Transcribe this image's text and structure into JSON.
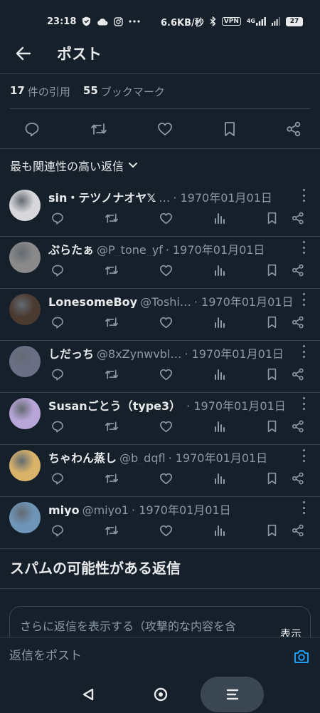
{
  "status_bar": {
    "time": "23:18",
    "left_icons": [
      "shield-icon",
      "cloud-icon",
      "instagram-icon",
      "more-dots-icon"
    ],
    "net_speed": "6.6KB/秒",
    "right_icons": [
      "bluetooth-icon",
      "vpn-icon",
      "signal-icon",
      "wifi-icon"
    ],
    "vpn_label": "VPN",
    "network_label": "4G",
    "battery": "27"
  },
  "header": {
    "back_icon": "arrow-left-icon",
    "title": "ポスト"
  },
  "stats": {
    "quotes_count": "17",
    "quotes_label": "件の引用",
    "bookmarks_count": "55",
    "bookmarks_label": "ブックマーク"
  },
  "post_actions": [
    "reply-icon",
    "repost-icon",
    "like-icon",
    "bookmark-icon",
    "share-icon"
  ],
  "sort": {
    "label": "最も関連性の高い返信",
    "icon": "chevron-down-icon"
  },
  "replies": [
    {
      "name": "sin・テツノナオヤ𝕏",
      "handle": "…",
      "date": "· 1970年01月01日",
      "avatar_color": "#d8d8dc"
    },
    {
      "name": "ぷらたぁ",
      "handle": "@P_tone_yf",
      "date": "· 1970年01月01日",
      "avatar_color": "#8a8a8a"
    },
    {
      "name": "LonesomeBoy",
      "handle": "@Toshi…",
      "date": "· 1970年01月01日",
      "avatar_color": "#4a3a30"
    },
    {
      "name": "しだっち",
      "handle": "@8xZynwvbl…",
      "date": "· 1970年01月01日",
      "avatar_color": "#6a6f86"
    },
    {
      "name": "Susanごとう（type3）",
      "handle": "",
      "date": "· 1970年01月01日",
      "avatar_color": "#b9a6d8"
    },
    {
      "name": "ちゃわん蒸し",
      "handle": "@b_dqfl",
      "date": "· 1970年01月01日",
      "avatar_color": "#d9b36a"
    },
    {
      "name": "miyo",
      "handle": "@miyo1",
      "date": "· 1970年01月01日",
      "avatar_color": "#6f95b8"
    }
  ],
  "reply_action_icons": [
    "reply-icon",
    "repost-icon",
    "like-icon",
    "views-icon",
    "bookmark-icon",
    "share-icon"
  ],
  "spam_section": {
    "title": "スパムの可能性がある返信",
    "description": "さらに返信を表示する（攻撃的な内容を含",
    "show_button": "表示"
  },
  "compose": {
    "placeholder": "返信をポスト",
    "icon": "camera-icon"
  },
  "nav": [
    "back-triangle-icon",
    "home-circle-icon",
    "recents-icon"
  ],
  "colors": {
    "background": "#15202b",
    "text": "#e7e9ea",
    "secondary": "#8b98a5",
    "divider": "#38444d",
    "accent": "#1d9bf0"
  }
}
